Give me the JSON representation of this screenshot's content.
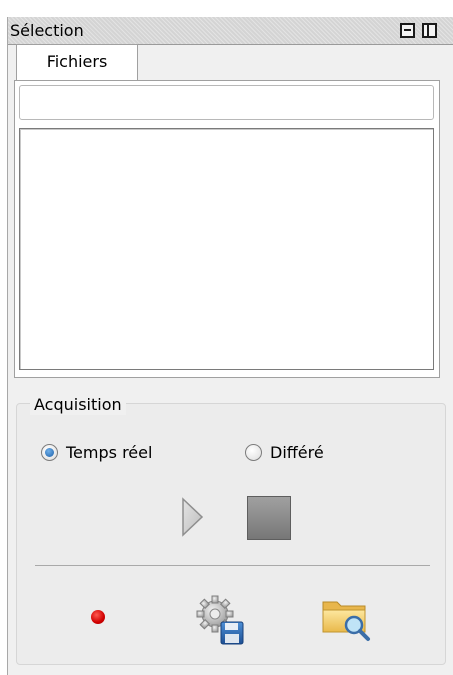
{
  "window": {
    "title": "Sélection"
  },
  "tabs": [
    {
      "label": "Fichiers",
      "active": true
    }
  ],
  "files": {
    "filter_value": "",
    "items": []
  },
  "acquisition": {
    "group_title": "Acquisition",
    "modes": [
      {
        "label": "Temps réel",
        "checked": true
      },
      {
        "label": "Différé",
        "checked": false
      }
    ],
    "icons": {
      "play": "play-icon",
      "stop": "stop-icon",
      "record": "record-icon",
      "settings": "gear-save-icon",
      "browse": "folder-search-icon"
    }
  },
  "colors": {
    "record": "#d00000",
    "radio_checked": "#1d5fa8",
    "panel_bg": "#f0f0f0"
  }
}
